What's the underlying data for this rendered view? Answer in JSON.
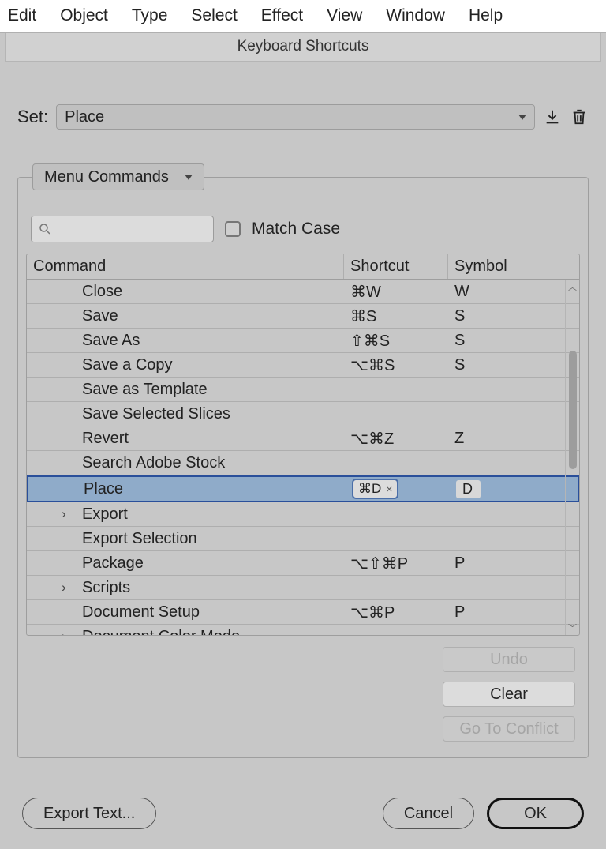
{
  "menubar": [
    "Edit",
    "Object",
    "Type",
    "Select",
    "Effect",
    "View",
    "Window",
    "Help"
  ],
  "dialog": {
    "title": "Keyboard Shortcuts"
  },
  "set": {
    "label": "Set:",
    "value": "Place"
  },
  "category": {
    "value": "Menu Commands"
  },
  "search": {
    "placeholder": ""
  },
  "matchcase": {
    "label": "Match Case"
  },
  "columns": {
    "command": "Command",
    "shortcut": "Shortcut",
    "symbol": "Symbol"
  },
  "rows": [
    {
      "cmd": "Close",
      "shortcut": "⌘W",
      "symbol": "W"
    },
    {
      "cmd": "Save",
      "shortcut": "⌘S",
      "symbol": "S"
    },
    {
      "cmd": "Save As",
      "shortcut": "⇧⌘S",
      "symbol": "S"
    },
    {
      "cmd": "Save a Copy",
      "shortcut": "⌥⌘S",
      "symbol": "S"
    },
    {
      "cmd": "Save as Template",
      "shortcut": "",
      "symbol": ""
    },
    {
      "cmd": "Save Selected Slices",
      "shortcut": "",
      "symbol": ""
    },
    {
      "cmd": "Revert",
      "shortcut": "⌥⌘Z",
      "symbol": "Z"
    },
    {
      "cmd": "Search Adobe Stock",
      "shortcut": "",
      "symbol": ""
    },
    {
      "cmd": "Place",
      "shortcut": "⌘D",
      "symbol": "D ",
      "selected": true,
      "chip": true
    },
    {
      "cmd": "Export",
      "shortcut": "",
      "symbol": "",
      "expand": true
    },
    {
      "cmd": "Export Selection",
      "shortcut": "",
      "symbol": ""
    },
    {
      "cmd": "Package",
      "shortcut": "⌥⇧⌘P",
      "symbol": "P"
    },
    {
      "cmd": "Scripts",
      "shortcut": "",
      "symbol": "",
      "expand": true
    },
    {
      "cmd": "Document Setup",
      "shortcut": "⌥⌘P",
      "symbol": "P"
    },
    {
      "cmd": "Document Color Mode",
      "shortcut": "",
      "symbol": "",
      "expand": true
    }
  ],
  "sideButtons": {
    "undo": "Undo",
    "clear": "Clear",
    "conflict": "Go To Conflict"
  },
  "bottom": {
    "export": "Export Text...",
    "cancel": "Cancel",
    "ok": "OK"
  }
}
